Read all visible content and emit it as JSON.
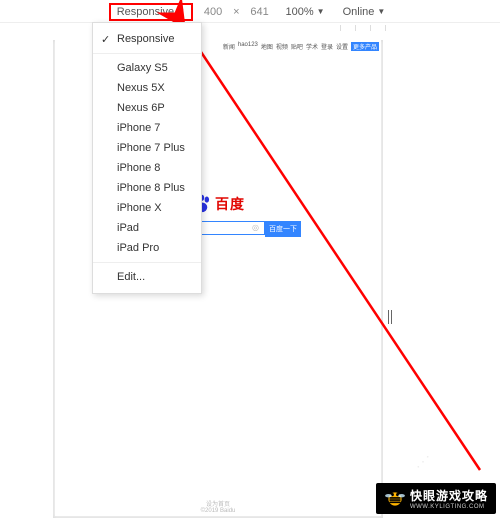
{
  "toolbar": {
    "device": "Responsive",
    "width": "400",
    "height": "641",
    "times": "×",
    "zoom": "100%",
    "throttle": "Online"
  },
  "device_menu": {
    "items": [
      {
        "label": "Responsive",
        "checked": true
      },
      {
        "label": "Galaxy S5"
      },
      {
        "label": "Nexus 5X"
      },
      {
        "label": "Nexus 6P"
      },
      {
        "label": "iPhone 7"
      },
      {
        "label": "iPhone 7 Plus"
      },
      {
        "label": "iPhone 8"
      },
      {
        "label": "iPhone 8 Plus"
      },
      {
        "label": "iPhone X"
      },
      {
        "label": "iPad"
      },
      {
        "label": "iPad Pro"
      }
    ],
    "edit": "Edit..."
  },
  "baidu": {
    "topnav": [
      "新闻",
      "hao123",
      "地图",
      "视频",
      "贴吧",
      "学术",
      "登录",
      "设置"
    ],
    "more": "更多产品",
    "brand": "百度",
    "search_btn": "百度一下",
    "footer1": "设为首页",
    "footer2": "©2019 Baidu"
  },
  "watermark": {
    "title": "快眼游戏攻略",
    "url": "WWW.KYLIGTING.COM"
  }
}
